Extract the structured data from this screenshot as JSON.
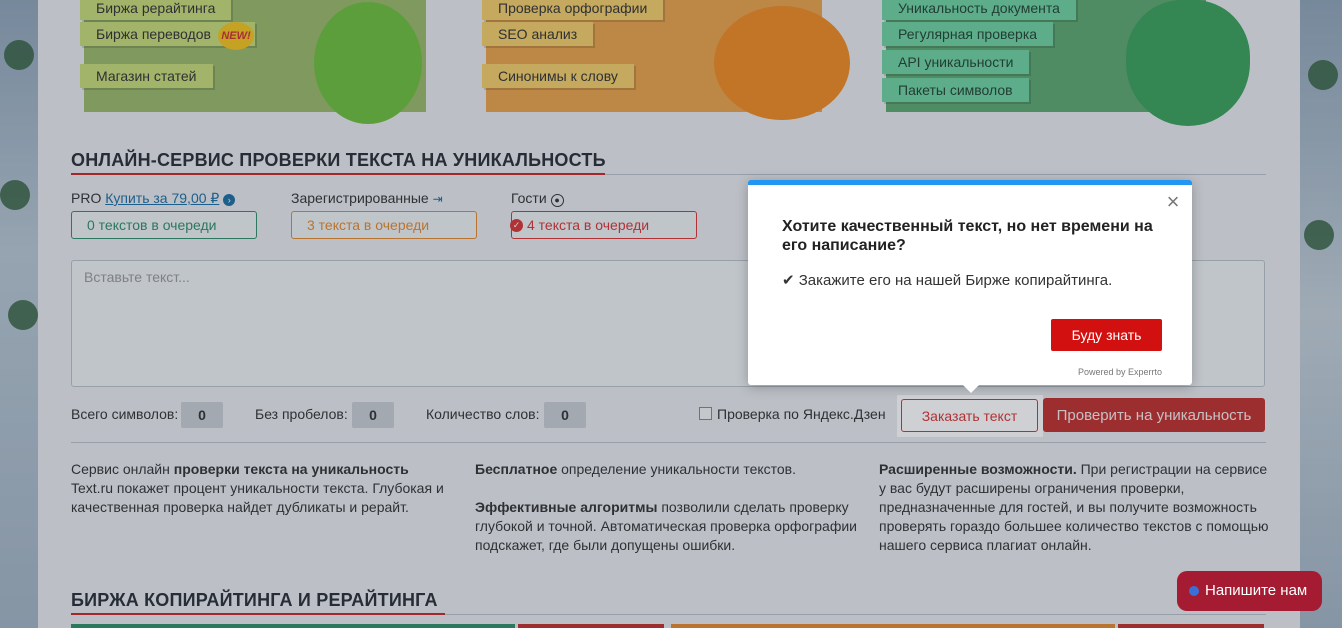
{
  "banners": {
    "green": [
      "Биржа рерайтинга",
      "Биржа переводов",
      "Магазин статей"
    ],
    "new_badge": "NEW!",
    "orange": [
      "Проверка орфографии",
      "SEO анализ",
      "Синонимы к слову"
    ],
    "teal": [
      "Уникальность документа",
      "Регулярная проверка",
      "API уникальности",
      "Пакеты символов"
    ]
  },
  "main": {
    "title": "ОНЛАЙН-СЕРВИС ПРОВЕРКИ ТЕКСТА НА УНИКАЛЬНОСТЬ",
    "pro_label": "PRO",
    "pro_link": "Купить за 79,00 ₽",
    "registered_label": "Зарегистрированные",
    "guests_label": "Гости",
    "queue_pro": "0 текстов в очереди",
    "queue_registered": "3 текста в очереди",
    "queue_guests": "4 текста в очереди",
    "textarea_placeholder": "Вставьте текст...",
    "total_chars_label": "Всего символов:",
    "total_chars": "0",
    "no_spaces_label": "Без пробелов:",
    "no_spaces": "0",
    "words_label": "Количество слов:",
    "words": "0",
    "yandex_check": "Проверка по Яндекс.Дзен",
    "order_button": "Заказать текст",
    "check_button": "Проверить на уникальность"
  },
  "info": {
    "col1_a": "Сервис онлайн ",
    "col1_b": "проверки текста на уникальность",
    "col1_c": "Text.ru покажет процент уникальности текста. Глубокая и качественная проверка найдет дубликаты и рерайт.",
    "col2_a": "Бесплатное",
    "col2_b": " определение уникальности текстов.",
    "col2_c": "Эффективные алгоритмы",
    "col2_d": " позволили сделать проверку глубокой и точной. Автоматическая проверка орфографии подскажет, где были допущены ошибки.",
    "col3_a": "Расширенные возможности.",
    "col3_b": " При регистрации на сервисе у вас будут расширены ограничения проверки, предназначенные для гостей, и вы получите возможность проверять гораздо большее количество текстов с помощью нашего сервиса плагиат онлайн."
  },
  "section2": {
    "title": "БИРЖА КОПИРАЙТИНГА И РЕРАЙТИНГА"
  },
  "chat": {
    "label": "Напишите нам"
  },
  "popup": {
    "title": "Хотите качественный текст, но нет времени на его написание?",
    "text": "✔ Закажите его на нашей Бирже копирайтинга.",
    "button": "Буду знать",
    "powered": "Powered by Experrto"
  },
  "colors": {
    "accent_red": "#c0302f",
    "popup_blue": "#2196f3",
    "chat_bg": "#a51b32"
  }
}
